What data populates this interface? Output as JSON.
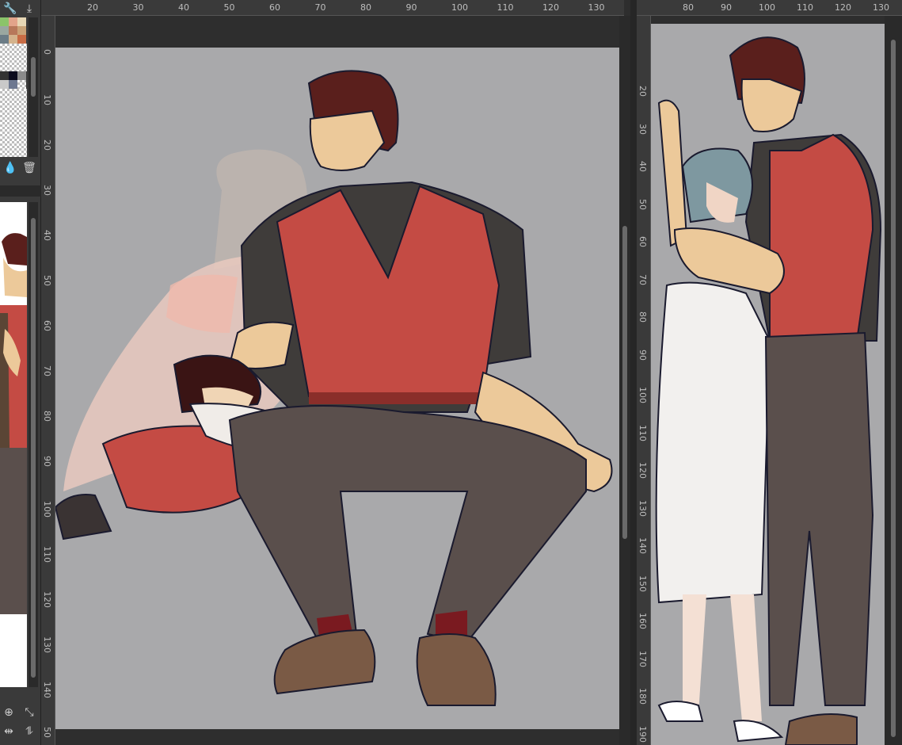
{
  "window": {
    "title": ""
  },
  "colors": {
    "panel": "#3a3a3a",
    "canvas_bg": "#a9a9ab",
    "vest": "#c44b44",
    "shirt": "#3f3c3a",
    "pants": "#5a4f4c",
    "skin": "#ecc99a",
    "hair": "#5a1f1c",
    "ruler_text": "#bdbdbd"
  },
  "left_strip": {
    "top_icons": [
      "wrench-icon",
      "download-icon"
    ],
    "bottom_icons": [
      "drop-add-icon",
      "trash-icon"
    ],
    "footer_icons": [
      "zoom-in-icon",
      "fit-icon",
      "flip-h-icon",
      "flip-v-icon"
    ]
  },
  "main_canvas": {
    "ruler_h": [
      "20",
      "30",
      "40",
      "50",
      "60",
      "70",
      "80",
      "90",
      "100",
      "110",
      "120",
      "130"
    ],
    "ruler_v": [
      "0",
      "10",
      "20",
      "30",
      "40",
      "50",
      "60",
      "70",
      "80",
      "90",
      "100",
      "110",
      "120",
      "130",
      "140",
      "50"
    ]
  },
  "side_canvas": {
    "ruler_h": [
      "80",
      "90",
      "100",
      "110",
      "120",
      "130"
    ],
    "ruler_v": [
      "20",
      "30",
      "40",
      "50",
      "60",
      "70",
      "80",
      "90",
      "100",
      "110",
      "120",
      "130",
      "140",
      "150",
      "160",
      "170",
      "180",
      "190"
    ]
  }
}
